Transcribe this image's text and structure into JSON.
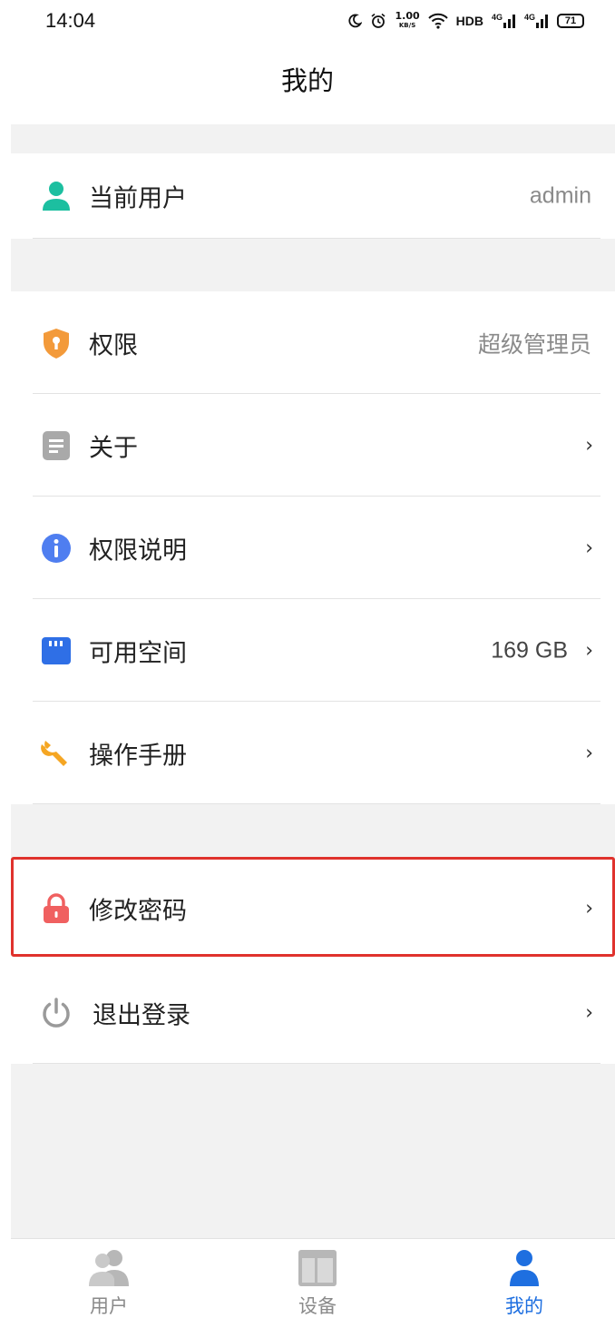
{
  "status_bar": {
    "time": "14:04",
    "speed_value": "1.00",
    "speed_unit": "KB/S",
    "hd": "HDB",
    "net1": "4G",
    "net2": "4G",
    "battery": "71"
  },
  "header": {
    "title": "我的"
  },
  "user_section": {
    "label": "当前用户",
    "value": "admin",
    "icon": "person-icon",
    "icon_color": "#1cbfa0"
  },
  "info_section": [
    {
      "label": "权限",
      "value": "超级管理员",
      "chevron": false,
      "icon": "shield-icon",
      "icon_color": "#f39a3a"
    },
    {
      "label": "关于",
      "value": "",
      "chevron": true,
      "icon": "document-icon",
      "icon_color": "#a9a9a9"
    },
    {
      "label": "权限说明",
      "value": "",
      "chevron": true,
      "icon": "info-icon",
      "icon_color": "#4f7ef0"
    },
    {
      "label": "可用空间",
      "value": "169 GB",
      "chevron": true,
      "icon": "sd-card-icon",
      "icon_color": "#2f6fe6"
    },
    {
      "label": "操作手册",
      "value": "",
      "chevron": true,
      "icon": "wrench-icon",
      "icon_color": "#f5a623"
    }
  ],
  "account_section": [
    {
      "label": "修改密码",
      "chevron": true,
      "icon": "lock-icon",
      "icon_color": "#f06060",
      "highlighted": true
    },
    {
      "label": "退出登录",
      "chevron": true,
      "icon": "power-icon",
      "icon_color": "#9a9a9a"
    }
  ],
  "chevron_glyph": "›",
  "tab_bar": {
    "tabs": [
      {
        "label": "用户",
        "icon": "users-icon",
        "active": false
      },
      {
        "label": "设备",
        "icon": "layout-icon",
        "active": false
      },
      {
        "label": "我的",
        "icon": "person-icon",
        "active": true
      }
    ],
    "active_color": "#1e6fe0",
    "inactive_color": "#8a8a8a"
  }
}
